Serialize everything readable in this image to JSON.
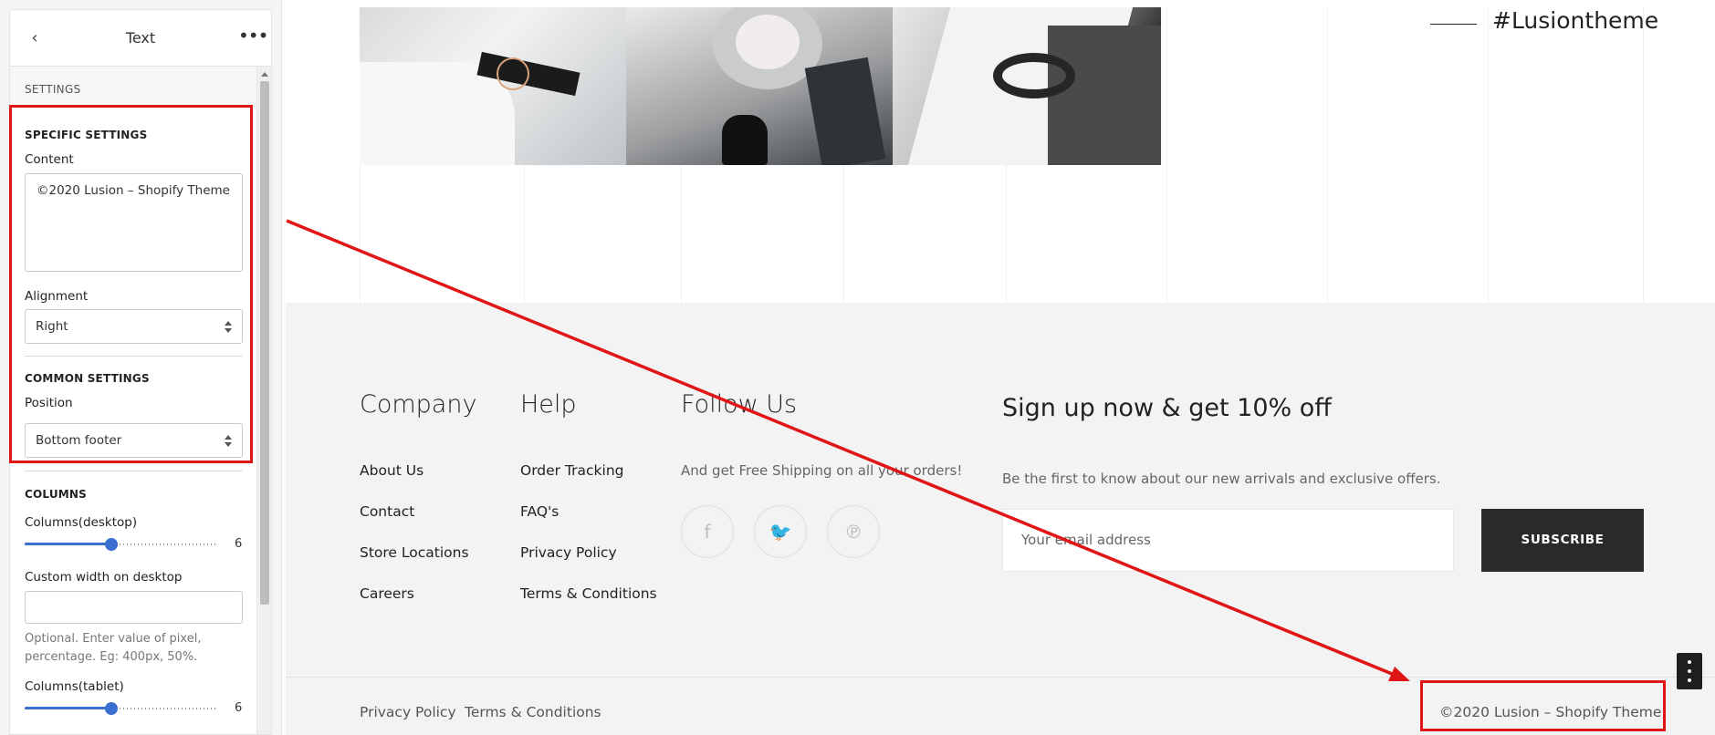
{
  "panel": {
    "title": "Text",
    "settings_bar": "SETTINGS",
    "specific_heading": "SPECIFIC SETTINGS",
    "content_label": "Content",
    "content_value": "©2020 Lusion – Shopify Theme",
    "alignment_label": "Alignment",
    "alignment_value": "Right",
    "common_heading": "COMMON SETTINGS",
    "position_label": "Position",
    "position_value": "Bottom footer",
    "columns_heading": "COLUMNS",
    "columns_desktop_label": "Columns(desktop)",
    "columns_desktop_value": "6",
    "columns_desktop_fraction": 0.45,
    "custom_width_label": "Custom width on desktop",
    "custom_width_value": "",
    "custom_width_help": "Optional. Enter value of pixel, percentage. Eg: 400px, 50%.",
    "columns_tablet_label": "Columns(tablet)",
    "columns_tablet_value": "6",
    "columns_tablet_fraction": 0.45
  },
  "preview": {
    "hashtag": "#Lusiontheme",
    "footer": {
      "company": {
        "title": "Company",
        "links": [
          "About Us",
          "Contact",
          "Store Locations",
          "Careers"
        ]
      },
      "help": {
        "title": "Help",
        "links": [
          "Order Tracking",
          "FAQ's",
          "Privacy Policy",
          "Terms & Conditions"
        ]
      },
      "follow": {
        "title": "Follow Us",
        "text": "And get Free Shipping on all your orders!",
        "icons": [
          "facebook-icon",
          "twitter-icon",
          "pinterest-icon"
        ],
        "glyphs": [
          "f",
          "🐦",
          "℗"
        ]
      },
      "signup": {
        "title": "Sign up now & get 10% off",
        "subtitle": "Be the first to know about our new arrivals and exclusive offers.",
        "placeholder": "Your email address",
        "button": "SUBSCRIBE"
      },
      "bottom_links": [
        "Privacy Policy",
        "Terms & Conditions"
      ],
      "copyright": "©2020 Lusion – Shopify Theme"
    }
  },
  "colors": {
    "annotation": "#e01515",
    "slider_accent": "#3a6fcf",
    "subscribe_bg": "#2a2a2a",
    "footer_bg": "#f3f3f3"
  }
}
